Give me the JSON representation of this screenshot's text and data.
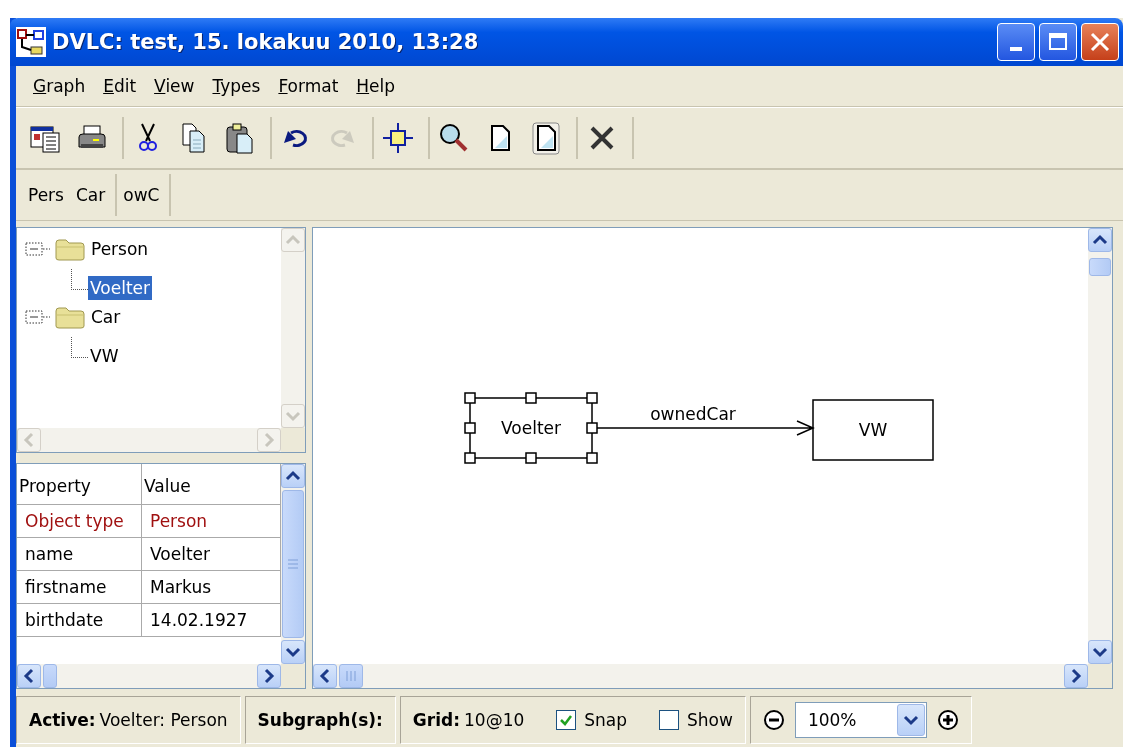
{
  "window": {
    "title": "DVLC: test, 15. lokakuu 2010, 13:28"
  },
  "menu": [
    "Graph",
    "Edit",
    "View",
    "Types",
    "Format",
    "Help"
  ],
  "toolbar_groups": [
    {
      "buttons": [
        {
          "kind": "properties",
          "disabled": false
        },
        {
          "kind": "print",
          "disabled": false
        }
      ]
    },
    {
      "buttons": [
        {
          "kind": "cut",
          "disabled": false
        },
        {
          "kind": "copy",
          "disabled": false
        },
        {
          "kind": "paste",
          "disabled": false
        }
      ]
    },
    {
      "buttons": [
        {
          "kind": "undo",
          "disabled": false
        },
        {
          "kind": "redo",
          "disabled": true
        }
      ]
    },
    {
      "buttons": [
        {
          "kind": "select",
          "disabled": false
        }
      ]
    },
    {
      "buttons": [
        {
          "kind": "zoom",
          "disabled": false
        },
        {
          "kind": "page",
          "disabled": false
        },
        {
          "kind": "page-framed",
          "disabled": false
        }
      ]
    },
    {
      "buttons": [
        {
          "kind": "delete",
          "disabled": false
        }
      ]
    }
  ],
  "palette_groups": [
    {
      "items": [
        "Pers",
        "Car"
      ]
    },
    {
      "items": [
        "owC"
      ]
    }
  ],
  "tree": [
    {
      "label": "Person",
      "expanded": true,
      "children": [
        {
          "label": "Voelter",
          "selected": true
        }
      ]
    },
    {
      "label": "Car",
      "expanded": true,
      "children": [
        {
          "label": "VW",
          "selected": false
        }
      ]
    }
  ],
  "properties": {
    "columns": [
      "Property",
      "Value"
    ],
    "rows": [
      {
        "kind": "type",
        "cells": [
          "Object type",
          "Person"
        ]
      },
      {
        "kind": "attribute",
        "cells": [
          "name",
          "Voelter"
        ]
      },
      {
        "kind": "attribute",
        "cells": [
          "firstname",
          "Markus"
        ]
      },
      {
        "kind": "attribute",
        "cells": [
          "birthdate",
          "14.02.1927"
        ]
      }
    ]
  },
  "diagram": {
    "nodes": [
      {
        "label": "Voelter",
        "selected": true
      },
      {
        "label": "VW",
        "selected": false
      }
    ],
    "edges": [
      {
        "label": "ownedCar"
      }
    ]
  },
  "status_bar": {
    "active_label": "Active:",
    "active_value": "Voelter: Person",
    "subgraph_label": "Subgraph(s):",
    "grid_label": "Grid:",
    "grid_value": "10@10",
    "snap": {
      "label": "Snap",
      "checked": true
    },
    "show": {
      "label": "Show",
      "checked": false
    },
    "zoom": "100%"
  }
}
